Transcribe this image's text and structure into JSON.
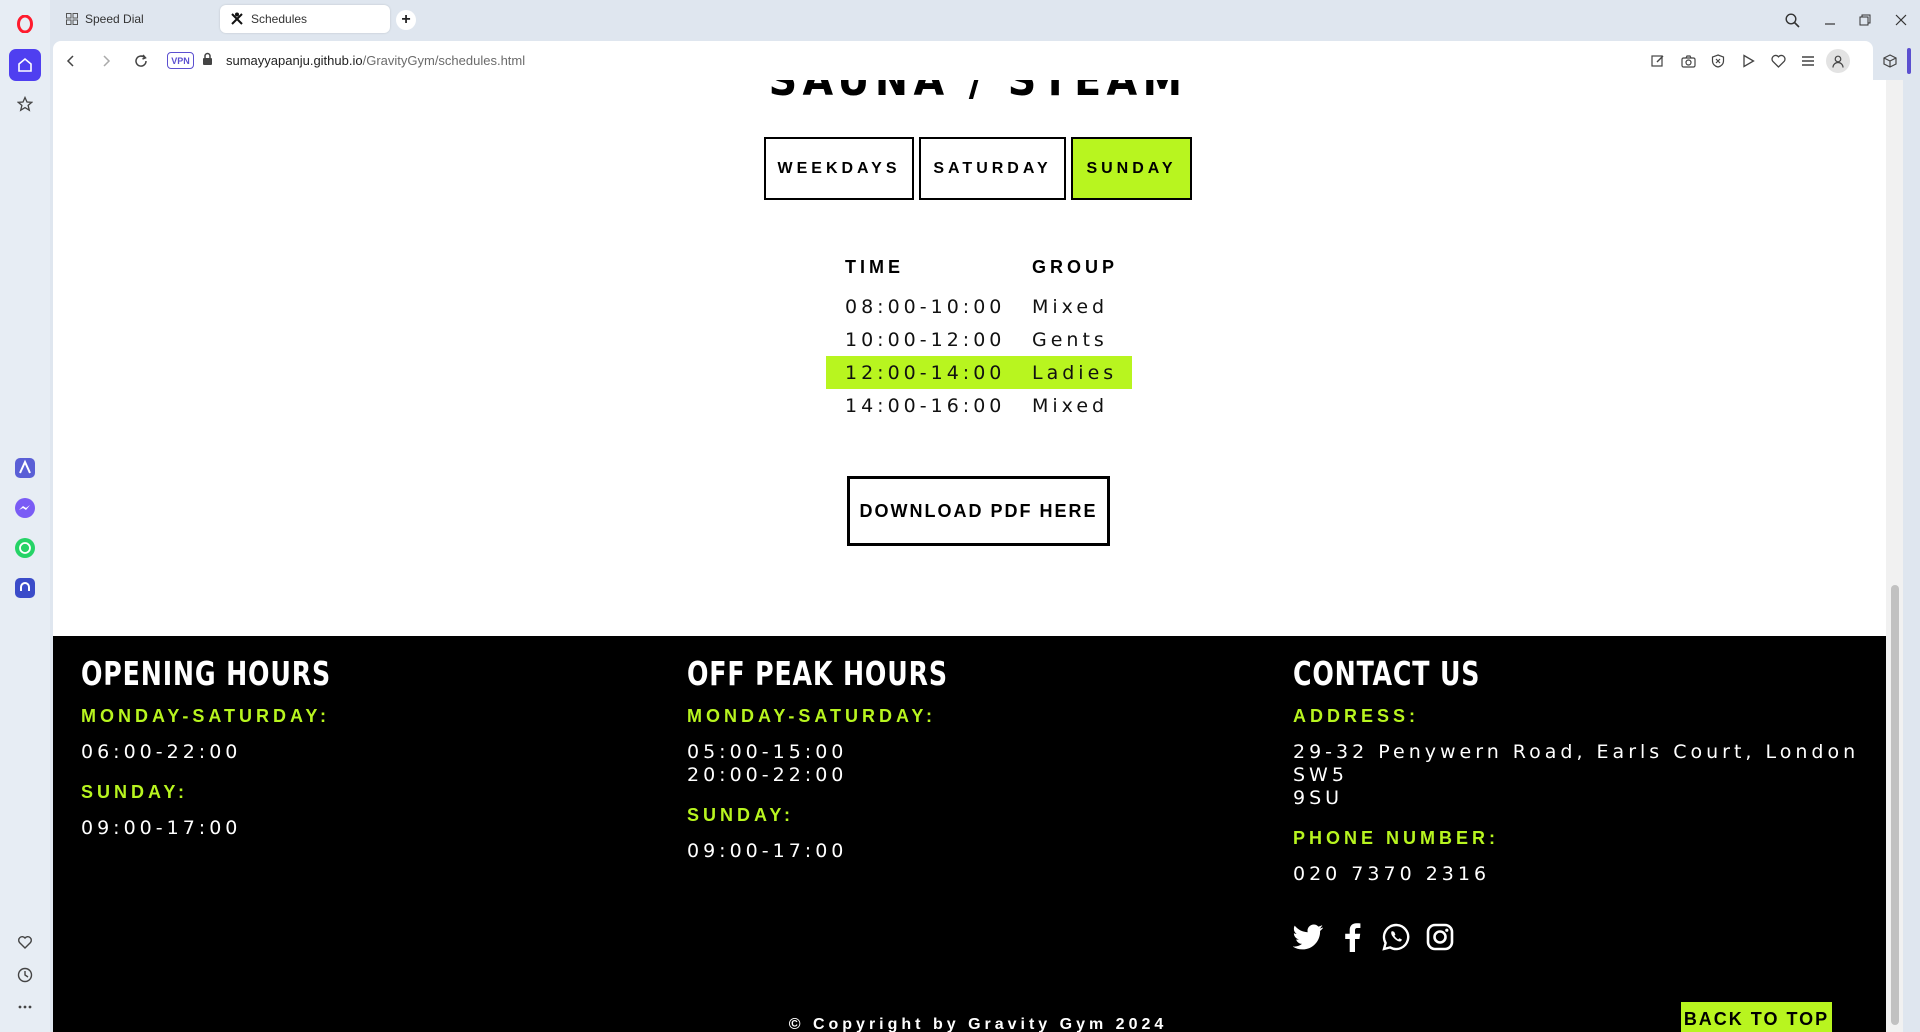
{
  "browser": {
    "tabs": [
      {
        "label": "Speed Dial",
        "icon": "grid-icon"
      },
      {
        "label": "Schedules",
        "icon": "gym-icon"
      }
    ],
    "url_host": "sumayyapanju.github.io",
    "url_path": "/GravityGym/schedules.html",
    "vpn_label": "VPN",
    "brand_color": "#ff1b2d",
    "accent_color": "#5b4fd0"
  },
  "page": {
    "heading": "SAUNA / STEAM",
    "day_tabs": [
      {
        "label": "WEEKDAYS",
        "active": false
      },
      {
        "label": "SATURDAY",
        "active": false
      },
      {
        "label": "SUNDAY",
        "active": true
      }
    ],
    "schedule": {
      "columns": [
        "TIME",
        "GROUP"
      ],
      "rows": [
        {
          "time": "08:00-10:00",
          "group": "Mixed",
          "highlighted": false
        },
        {
          "time": "10:00-12:00",
          "group": "Gents",
          "highlighted": false
        },
        {
          "time": "12:00-14:00",
          "group": "Ladies",
          "highlighted": true
        },
        {
          "time": "14:00-16:00",
          "group": "Mixed",
          "highlighted": false
        }
      ]
    },
    "download_label": "DOWNLOAD PDF HERE",
    "accent_color": "#b8f51f"
  },
  "footer": {
    "opening": {
      "title": "OPENING HOURS",
      "label1": "MONDAY-SATURDAY:",
      "value1": "06:00-22:00",
      "label2": "SUNDAY:",
      "value2": "09:00-17:00"
    },
    "offpeak": {
      "title": "OFF PEAK HOURS",
      "label1": "MONDAY-SATURDAY:",
      "value1": "05:00-15:00\n20:00-22:00",
      "label2": "SUNDAY:",
      "value2": "09:00-17:00"
    },
    "contact": {
      "title": "CONTACT US",
      "label1": "ADDRESS:",
      "value1": "29-32 Penywern Road, Earls Court, London SW5\n9SU",
      "label2": "PHONE NUMBER:",
      "value2": "020 7370 2316"
    },
    "socials": [
      "twitter-icon",
      "facebook-icon",
      "whatsapp-icon",
      "instagram-icon"
    ],
    "copyright": "© Copyright by Gravity Gym 2024",
    "back_to_top": "BACK TO TOP"
  }
}
